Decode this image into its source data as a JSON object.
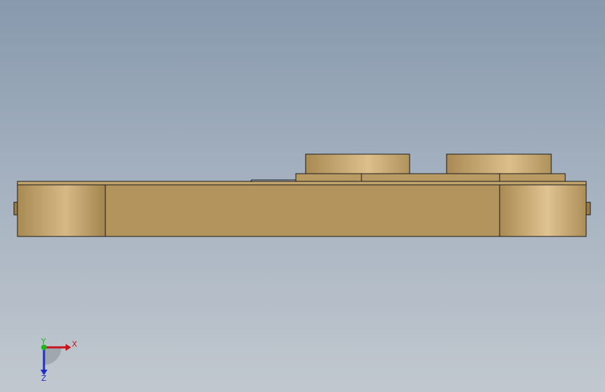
{
  "viewport": {
    "background_top": "#8799ad",
    "background_bottom": "#c1c8cf"
  },
  "model": {
    "color_base": "#b3945d",
    "color_highlight": "#dcbf8c",
    "color_shadow": "#9b7c47",
    "edge_color": "#1a1a1a"
  },
  "triad": {
    "x_label": "X",
    "y_label": "Y",
    "z_label": "Z",
    "x_color": "#c8141e",
    "y_color": "#1fb41f",
    "z_color": "#1e2fc8"
  }
}
